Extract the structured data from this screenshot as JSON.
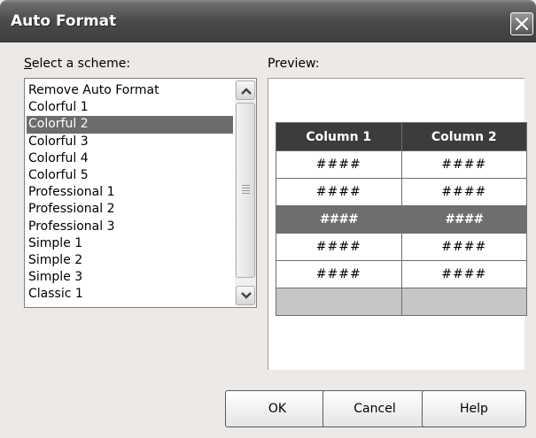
{
  "window": {
    "title": "Auto Format",
    "close_icon": "close-icon"
  },
  "scheme": {
    "label": "Select a scheme:",
    "items": [
      "Remove Auto Format",
      "Colorful 1",
      "Colorful 2",
      "Colorful 3",
      "Colorful 4",
      "Colorful 5",
      "Professional 1",
      "Professional 2",
      "Professional 3",
      "Simple 1",
      "Simple 2",
      "Simple 3",
      "Classic 1"
    ],
    "selected_index": 2
  },
  "preview": {
    "label": "Preview:",
    "headers": [
      "Column 1",
      "Column 2"
    ],
    "rows": [
      [
        "####",
        "####"
      ],
      [
        "####",
        "####"
      ],
      [
        "####",
        "####"
      ],
      [
        "####",
        "####"
      ],
      [
        "####",
        "####"
      ]
    ],
    "highlighted_row": 2,
    "colors": {
      "header_bg": "#3c3c3c",
      "highlight_bg": "#6e6e6e",
      "footer_bg": "#c6c6c6"
    }
  },
  "buttons": {
    "ok": "OK",
    "cancel": "Cancel",
    "help": "Help"
  }
}
